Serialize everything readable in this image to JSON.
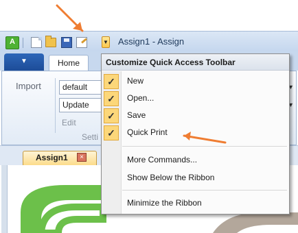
{
  "window": {
    "title": "Assign1 - Assign"
  },
  "app_icon": {
    "letter": "A",
    "color": "#4fb234"
  },
  "qat": {
    "icons": [
      "new-doc-icon",
      "open-folder-icon",
      "save-disk-icon",
      "quick-print-icon"
    ],
    "dropdown_glyph": "▼"
  },
  "ribbon": {
    "app_menu_glyph": "▼",
    "tabs": [
      {
        "label": "Home"
      }
    ],
    "import_label": "Import",
    "combo_default": "default",
    "combo_update": "Update",
    "edit_label": "Edit",
    "settings_label": "Setti",
    "dd_glyph": "▼"
  },
  "document": {
    "tab_label": "Assign1",
    "close_glyph": "×"
  },
  "qat_menu": {
    "title": "Customize Quick Access Toolbar",
    "items": [
      {
        "label": "New",
        "checked": true,
        "check_glyph": "✓"
      },
      {
        "label": "Open...",
        "checked": true,
        "check_glyph": "✓"
      },
      {
        "label": "Save",
        "checked": true,
        "check_glyph": "✓"
      },
      {
        "label": "Quick Print",
        "checked": true,
        "check_glyph": "✓"
      }
    ],
    "more_commands": "More Commands...",
    "show_below": "Show Below the Ribbon",
    "minimize": "Minimize the Ribbon"
  },
  "colors": {
    "annotation_arrow": "#ef7d32",
    "check_highlight": "#fcd77a",
    "title_blue": "#1e395b"
  }
}
